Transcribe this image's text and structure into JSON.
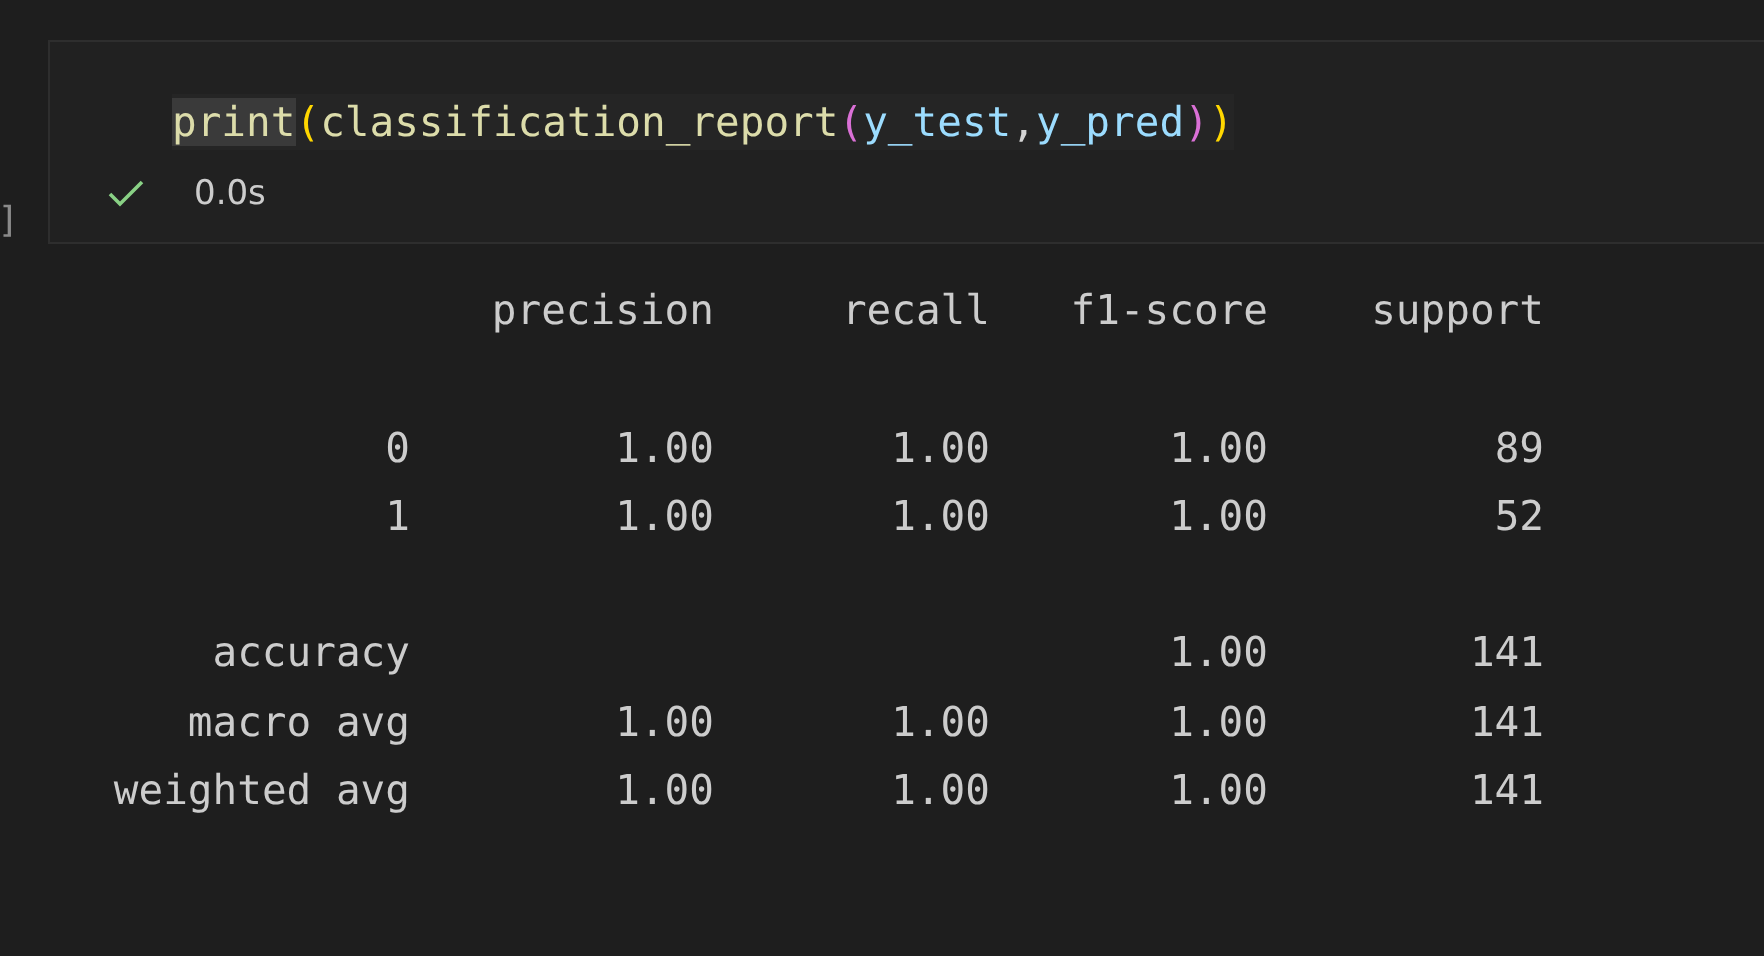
{
  "cell": {
    "execution_count": "]",
    "code": [
      {
        "kind": "function",
        "text": "print",
        "highlighted": true
      },
      {
        "kind": "bracket1",
        "text": "(",
        "highlighted": false
      },
      {
        "kind": "function",
        "text": "classification_report",
        "highlighted": false
      },
      {
        "kind": "bracket2",
        "text": "(",
        "highlighted": false
      },
      {
        "kind": "variable",
        "text": "y_test",
        "highlighted": false
      },
      {
        "kind": "punct",
        "text": ",",
        "highlighted": false
      },
      {
        "kind": "variable",
        "text": "y_pred",
        "highlighted": false
      },
      {
        "kind": "bracket2",
        "text": ")",
        "highlighted": false
      },
      {
        "kind": "bracket1",
        "text": ")",
        "highlighted": false
      }
    ],
    "status": {
      "succeeded": true,
      "duration": "0.0s"
    }
  },
  "output": {
    "columns": [
      "precision",
      "recall",
      "f1-score",
      "support"
    ],
    "groups": [
      [
        {
          "label": "0",
          "precision": "1.00",
          "recall": "1.00",
          "f1": "1.00",
          "support": "89"
        },
        {
          "label": "1",
          "precision": "1.00",
          "recall": "1.00",
          "f1": "1.00",
          "support": "52"
        }
      ],
      [
        {
          "label": "accuracy",
          "f1": "1.00",
          "support": "141"
        },
        {
          "label": "macro avg",
          "precision": "1.00",
          "recall": "1.00",
          "f1": "1.00",
          "support": "141"
        },
        {
          "label": "weighted avg",
          "precision": "1.00",
          "recall": "1.00",
          "f1": "1.00",
          "support": "141"
        }
      ]
    ]
  }
}
